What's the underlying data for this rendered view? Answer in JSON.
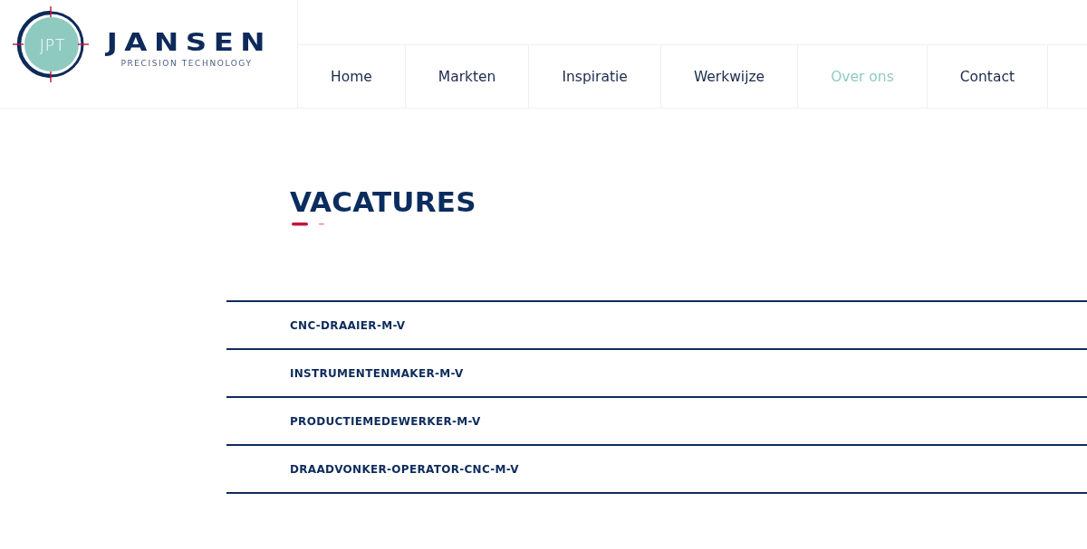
{
  "header": {
    "logo": {
      "badge": "JPT",
      "name": "JANSEN",
      "tagline": "PRECISION TECHNOLOGY"
    },
    "nav": [
      {
        "label": "Home",
        "selected": false
      },
      {
        "label": "Markten",
        "selected": false
      },
      {
        "label": "Inspiratie",
        "selected": false
      },
      {
        "label": "Werkwijze",
        "selected": false
      },
      {
        "label": "Over ons",
        "selected": true
      },
      {
        "label": "Contact",
        "selected": false
      }
    ]
  },
  "page": {
    "title": "VACATURES",
    "vacancies": [
      "CNC-DRAAIER-M-V",
      "INSTRUMENTENMAKER-M-V",
      "PRODUCTIEMEDEWERKER-M-V",
      "DRAADVONKER-OPERATOR-CNC-M-V"
    ]
  }
}
